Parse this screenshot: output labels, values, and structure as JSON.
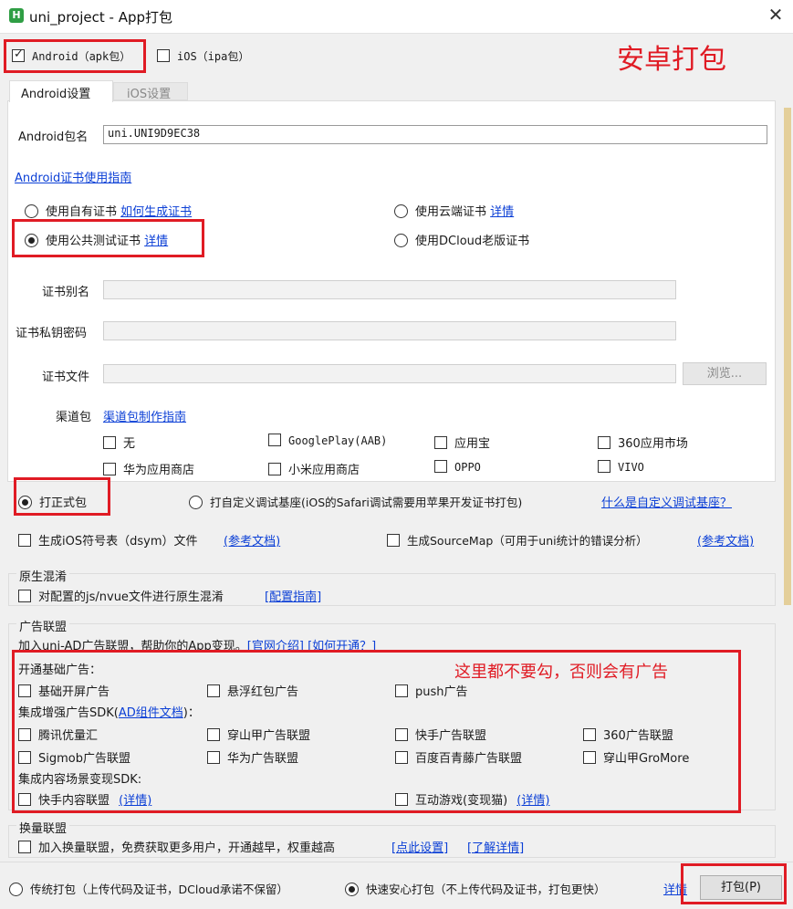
{
  "window": {
    "title": "uni_project - App打包",
    "icon": "H"
  },
  "platforms": {
    "android": "Android（apk包）",
    "ios": "iOS（ipa包）"
  },
  "annotations": {
    "android_pack": "安卓打包",
    "no_ads": "这里都不要勾，否则会有广告"
  },
  "tabs": {
    "android": "Android设置",
    "ios": "iOS设置"
  },
  "android": {
    "package_label": "Android包名",
    "package_value": "uni.UNI9D9EC38",
    "cert_guide": "Android证书使用指南",
    "cert_options": {
      "own": "使用自有证书",
      "own_link": "如何生成证书",
      "cloud": "使用云端证书",
      "cloud_link": "详情",
      "public": "使用公共测试证书",
      "public_link": "详情",
      "dcloud_old": "使用DCloud老版证书"
    },
    "alias_label": "证书别名",
    "password_label": "证书私钥密码",
    "file_label": "证书文件",
    "browse_button": "浏览...",
    "channel_label": "渠道包",
    "channel_link": "渠道包制作指南",
    "channels": [
      "无",
      "GooglePlay(AAB)",
      "应用宝",
      "360应用市场",
      "华为应用商店",
      "小米应用商店",
      "OPPO",
      "VIVO"
    ]
  },
  "build_type": {
    "formal": "打正式包",
    "custom": "打自定义调试基座(iOS的Safari调试需要用苹果开发证书打包)",
    "custom_link": "什么是自定义调试基座？"
  },
  "extra": {
    "dsym": "生成iOS符号表（dsym）文件",
    "dsym_link": "(参考文档)",
    "sourcemap": "生成SourceMap（可用于uni统计的错误分析）",
    "sourcemap_link": "(参考文档)"
  },
  "obfuscation": {
    "title": "原生混淆",
    "option": "对配置的js/nvue文件进行原生混淆",
    "link": "[配置指南]"
  },
  "ads": {
    "title": "广告联盟",
    "intro": "加入uni-AD广告联盟，帮助你的App变现。",
    "intro_link1": "[官网介绍]",
    "intro_link2": "[如何开通？]",
    "basic_title": "开通基础广告：",
    "basic": [
      "基础开屏广告",
      "悬浮红包广告",
      "push广告"
    ],
    "sdk_title_pre": "集成增强广告SDK(",
    "sdk_title_link": "AD组件文档",
    "sdk_title_post": ")：",
    "sdk_row1": [
      "腾讯优量汇",
      "穿山甲广告联盟",
      "快手广告联盟",
      "360广告联盟"
    ],
    "sdk_row2": [
      "Sigmob广告联盟",
      "华为广告联盟",
      "百度百青藤广告联盟",
      "穿山甲GroMore"
    ],
    "content_title": "集成内容场景变现SDK:",
    "content1": "快手内容联盟",
    "content1_link": "(详情)",
    "content2": "互动游戏(变现猫)",
    "content2_link": "(详情)"
  },
  "exchange": {
    "title": "换量联盟",
    "option": "加入换量联盟，免费获取更多用户，开通越早，权重越高",
    "link1": "[点此设置]",
    "link2": "[了解详情]"
  },
  "footer": {
    "traditional": "传统打包（上传代码及证书，DCloud承诺不保留）",
    "fast": "快速安心打包（不上传代码及证书，打包更快）",
    "fast_link": "详情",
    "pack_button": "打包(P)"
  }
}
